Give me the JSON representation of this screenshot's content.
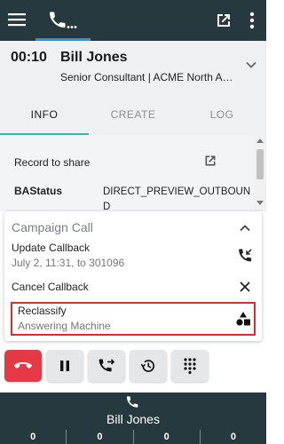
{
  "header": {
    "menu_icon": "hamburger-menu-icon",
    "phone_tab_icon": "phone-icon",
    "popout_icon": "open-in-new-icon",
    "more_icon": "more-vert-icon",
    "active_tab_color": "#2196f3",
    "background": "#26393f"
  },
  "call": {
    "timer": "00:10",
    "caller_name": "Bill Jones",
    "subtitle": "Senior Consultant | ACME North America",
    "expand_icon": "chevron-down-icon"
  },
  "tabs": [
    {
      "label": "INFO",
      "active": true
    },
    {
      "label": "CREATE",
      "active": false
    },
    {
      "label": "LOG",
      "active": false
    }
  ],
  "info": {
    "record_to_share": "Record to share",
    "record_icon": "open-in-new-icon",
    "ba_status_label": "BAStatus",
    "ba_status_value": "DIRECT_PREVIEW_OUTBOUND"
  },
  "campaign": {
    "title": "Campaign Call",
    "collapse_icon": "chevron-up-icon",
    "update_callback": {
      "label": "Update Callback",
      "detail": "July 2, 11:31, to 301096",
      "icon": "callback-icon"
    },
    "cancel_callback": {
      "label": "Cancel Callback",
      "icon": "close-icon"
    },
    "reclassify": {
      "label": "Reclassify",
      "value": "Answering Machine",
      "icon": "shapes-icon",
      "highlight_color": "#d32f2f"
    }
  },
  "controls": [
    {
      "name": "hangup-button",
      "icon": "call-end-icon",
      "color": "#e53946"
    },
    {
      "name": "hold-button",
      "icon": "pause-icon"
    },
    {
      "name": "transfer-button",
      "icon": "phone-forward-icon"
    },
    {
      "name": "history-button",
      "icon": "history-icon"
    },
    {
      "name": "dialpad-button",
      "icon": "dialpad-icon"
    }
  ],
  "footer": {
    "icon": "phone-icon",
    "name": "Bill Jones",
    "stats": [
      "0",
      "0",
      "0",
      "0"
    ]
  }
}
